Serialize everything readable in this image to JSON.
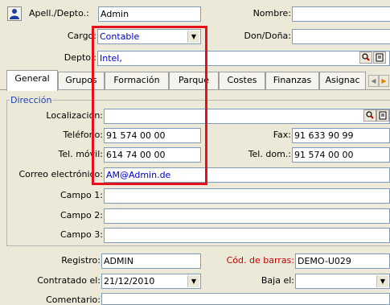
{
  "header": {
    "apell_label": "Apell./Depto.:",
    "apell_value": "Admin",
    "nombre_label": "Nombre:",
    "nombre_value": "",
    "cargo_label": "Cargo:",
    "cargo_value": "Contable",
    "don_label": "Don/Doña:",
    "don_value": "",
    "depto_label": "Depto.:",
    "depto_value": "Intel,"
  },
  "tabs": [
    {
      "label": "General",
      "active": true
    },
    {
      "label": "Grupos",
      "active": false
    },
    {
      "label": "Formación",
      "active": false
    },
    {
      "label": "Parque",
      "active": false
    },
    {
      "label": "Costes",
      "active": false
    },
    {
      "label": "Finanzas",
      "active": false
    },
    {
      "label": "Asignac",
      "active": false
    }
  ],
  "direccion": {
    "section_label": "Dirección",
    "localizacion_label": "Localización:",
    "localizacion_value": "",
    "telefono_label": "Teléfono:",
    "telefono_value": "91 574 00 00",
    "fax_label": "Fax:",
    "fax_value": "91 633 90 99",
    "movil_label": "Tel. móvil:",
    "movil_value": "614 74 00 00",
    "teldom_label": "Tel. dom.:",
    "teldom_value": "91 574 00 00",
    "correo_label": "Correo electrónico:",
    "correo_value": "AM@Admin.de",
    "campo1_label": "Campo 1:",
    "campo2_label": "Campo 2:",
    "campo3_label": "Campo 3:"
  },
  "bottom": {
    "registro_label": "Registro:",
    "registro_value": "ADMIN",
    "barras_label": "Cód. de barras:",
    "barras_value": "DEMO-U029",
    "contratado_label": "Contratado el:",
    "contratado_value": "21/12/2010",
    "baja_label": "Baja el:",
    "baja_value": "",
    "comentario_label": "Comentario:",
    "comentario_value": ""
  },
  "colors": {
    "highlight_box": "#e8101a",
    "link_blue": "#0000c8",
    "required_red": "#c00000",
    "panel_bg": "#ece9d8"
  },
  "icons": [
    "user-icon",
    "search-icon",
    "details-icon",
    "dropdown-arrow-icon",
    "tab-scroll-left-icon",
    "tab-scroll-right-icon"
  ]
}
